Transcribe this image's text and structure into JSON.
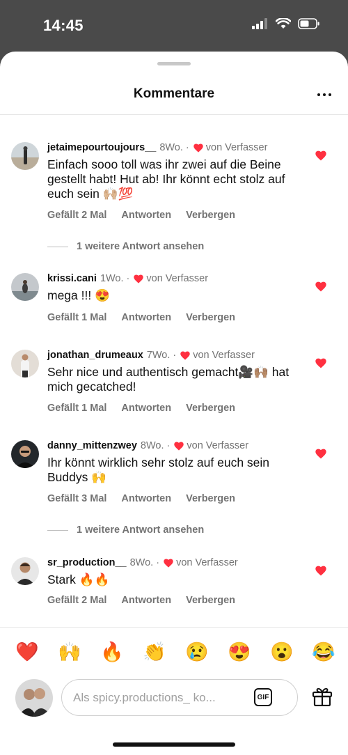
{
  "status_bar": {
    "time": "14:45"
  },
  "header": {
    "title": "Kommentare"
  },
  "comments": [
    {
      "username": "jetaimepourtoujours__",
      "age": "8Wo.",
      "author_like": "von Verfasser",
      "text": "Einfach sooo toll was ihr zwei auf die Beine gestellt habt! Hut ab! Ihr könnt echt stolz auf euch sein 🙌🏼💯",
      "likes": "Gefällt 2 Mal",
      "reply": "Antworten",
      "hide": "Verbergen",
      "more_replies": "1 weitere Antwort ansehen"
    },
    {
      "username": "krissi.cani",
      "age": "1Wo.",
      "author_like": "von Verfasser",
      "text": "mega !!! 😍",
      "likes": "Gefällt 1 Mal",
      "reply": "Antworten",
      "hide": "Verbergen"
    },
    {
      "username": "jonathan_drumeaux",
      "age": "7Wo.",
      "author_like": "von Verfasser",
      "text": "Sehr nice und authentisch gemacht🎥🙌🏽 hat mich gecatched!",
      "likes": "Gefällt 1 Mal",
      "reply": "Antworten",
      "hide": "Verbergen"
    },
    {
      "username": "danny_mittenzwey",
      "age": "8Wo.",
      "author_like": "von Verfasser",
      "text": "Ihr könnt wirklich sehr stolz auf euch sein Buddys 🙌",
      "likes": "Gefällt 3 Mal",
      "reply": "Antworten",
      "hide": "Verbergen",
      "more_replies": "1 weitere Antwort ansehen"
    },
    {
      "username": "sr_production__",
      "age": "8Wo.",
      "author_like": "von Verfasser",
      "text": "Stark 🔥🔥",
      "likes": "Gefällt 2 Mal",
      "reply": "Antworten",
      "hide": "Verbergen"
    }
  ],
  "quick_emojis": [
    "❤️",
    "🙌",
    "🔥",
    "👏",
    "😢",
    "😍",
    "😮",
    "😂"
  ],
  "composer": {
    "placeholder": "Als spicy.productions_ ko...",
    "gif_label": "GIF"
  },
  "colors": {
    "heart": "#ff3040",
    "secondary_text": "#737373"
  }
}
